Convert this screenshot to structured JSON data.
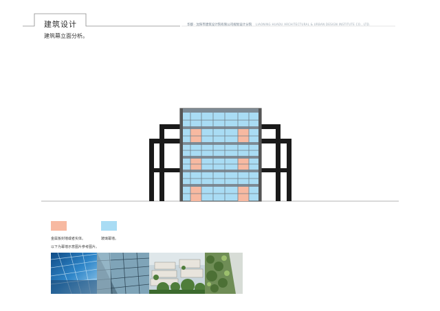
{
  "header": {
    "section_title": "建筑设计",
    "subtitle": "建筑幕立面分析。",
    "company_cn": "华都 · 沈阳市建筑设计院有限公司规划设计分院",
    "company_en": "LIAONING HUADU ARCHITECTURAL & URBAN DESIGN INSTITUTE CO., LTD."
  },
  "legend": {
    "items": [
      {
        "color": "#f7b9a1",
        "label": "金属板封墙或者实体。"
      },
      {
        "color": "#a9dcf4",
        "label": "玻璃幕墙。"
      }
    ],
    "note": "以下为幕墙示意图片参考图片。"
  },
  "colors": {
    "frame": "#1a1a1a",
    "glass": "#a9dcf4",
    "panel": "#f7b9a1",
    "mullion": "#6f7c86"
  }
}
